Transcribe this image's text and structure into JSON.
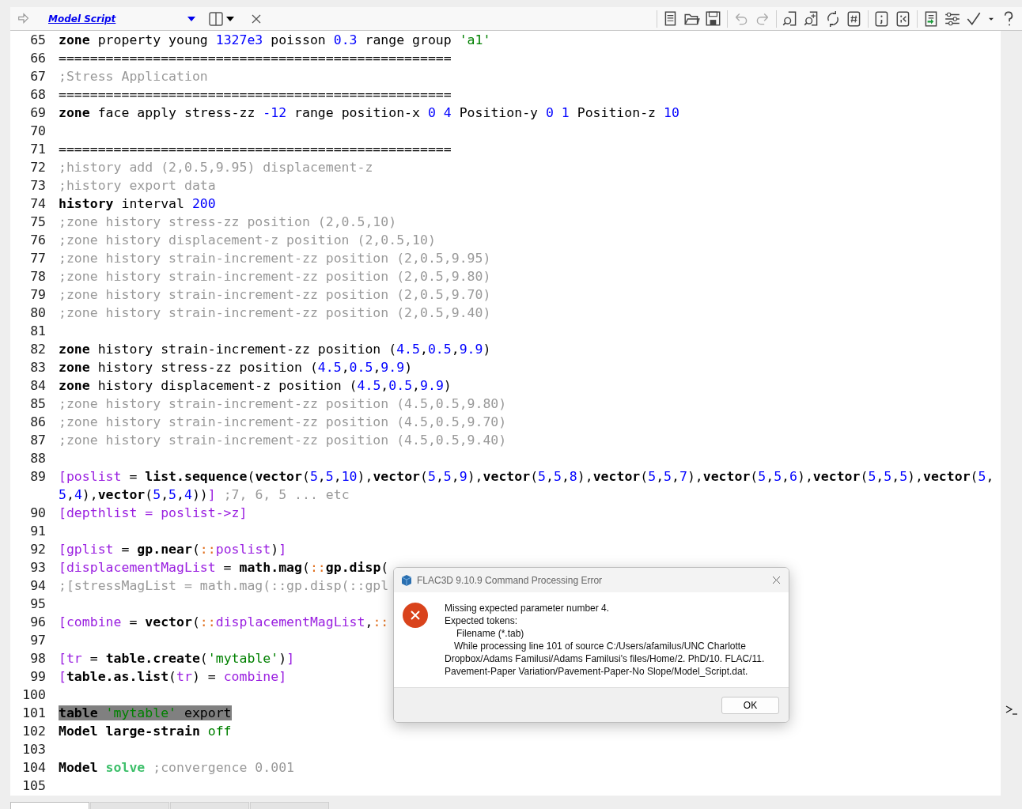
{
  "editor_tab": {
    "title": "Model Script"
  },
  "code": [
    {
      "n": "65",
      "tokens": [
        {
          "t": "zone",
          "kind": "kw"
        },
        {
          "t": " property young ",
          "kind": "plain"
        },
        {
          "t": "1327e3",
          "kind": "num"
        },
        {
          "t": " poisson ",
          "kind": "plain"
        },
        {
          "t": "0.3",
          "kind": "num"
        },
        {
          "t": " range group ",
          "kind": "plain"
        },
        {
          "t": "'a1'",
          "kind": "str"
        }
      ]
    },
    {
      "n": "66",
      "tokens": [
        {
          "t": "==================================================",
          "kind": "plain"
        }
      ]
    },
    {
      "n": "67",
      "tokens": [
        {
          "t": ";Stress Application",
          "kind": "cmt"
        }
      ]
    },
    {
      "n": "68",
      "tokens": [
        {
          "t": "==================================================",
          "kind": "plain"
        }
      ]
    },
    {
      "n": "69",
      "tokens": [
        {
          "t": "zone",
          "kind": "kw"
        },
        {
          "t": " face apply stress-zz ",
          "kind": "plain"
        },
        {
          "t": "-12",
          "kind": "num"
        },
        {
          "t": " range position-x ",
          "kind": "plain"
        },
        {
          "t": "0 4",
          "kind": "num"
        },
        {
          "t": " Position-y ",
          "kind": "plain"
        },
        {
          "t": "0 1",
          "kind": "num"
        },
        {
          "t": " Position-z ",
          "kind": "plain"
        },
        {
          "t": "10",
          "kind": "num"
        }
      ]
    },
    {
      "n": "70"
    },
    {
      "n": "71",
      "tokens": [
        {
          "t": "==================================================",
          "kind": "plain"
        }
      ]
    },
    {
      "n": "72",
      "tokens": [
        {
          "t": ";history add (2,0.5,9.95) displacement-z",
          "kind": "cmt"
        }
      ]
    },
    {
      "n": "73",
      "tokens": [
        {
          "t": ";history export data",
          "kind": "cmt"
        }
      ]
    },
    {
      "n": "74",
      "tokens": [
        {
          "t": "history",
          "kind": "kw"
        },
        {
          "t": " interval ",
          "kind": "plain"
        },
        {
          "t": "200",
          "kind": "num"
        }
      ]
    },
    {
      "n": "75",
      "tokens": [
        {
          "t": ";zone history stress-zz position (2,0.5,10)",
          "kind": "cmt"
        }
      ]
    },
    {
      "n": "76",
      "tokens": [
        {
          "t": ";zone history displacement-z position (2,0.5,10)",
          "kind": "cmt"
        }
      ]
    },
    {
      "n": "77",
      "tokens": [
        {
          "t": ";zone history strain-increment-zz position (2,0.5,9.95)",
          "kind": "cmt"
        }
      ]
    },
    {
      "n": "78",
      "tokens": [
        {
          "t": ";zone history strain-increment-zz position (2,0.5,9.80)",
          "kind": "cmt"
        }
      ]
    },
    {
      "n": "79",
      "tokens": [
        {
          "t": ";zone history strain-increment-zz position (2,0.5,9.70)",
          "kind": "cmt"
        }
      ]
    },
    {
      "n": "80",
      "tokens": [
        {
          "t": ";zone history strain-increment-zz position (2,0.5,9.40)",
          "kind": "cmt"
        }
      ]
    },
    {
      "n": "81"
    },
    {
      "n": "82",
      "tokens": [
        {
          "t": "zone",
          "kind": "kw"
        },
        {
          "t": " history strain-increment-zz position (",
          "kind": "plain"
        },
        {
          "t": "4.5",
          "kind": "num"
        },
        {
          "t": ",",
          "kind": "plain"
        },
        {
          "t": "0.5",
          "kind": "num"
        },
        {
          "t": ",",
          "kind": "plain"
        },
        {
          "t": "9.9",
          "kind": "num"
        },
        {
          "t": ")",
          "kind": "plain"
        }
      ]
    },
    {
      "n": "83",
      "tokens": [
        {
          "t": "zone",
          "kind": "kw"
        },
        {
          "t": " history stress-zz position (",
          "kind": "plain"
        },
        {
          "t": "4.5",
          "kind": "num"
        },
        {
          "t": ",",
          "kind": "plain"
        },
        {
          "t": "0.5",
          "kind": "num"
        },
        {
          "t": ",",
          "kind": "plain"
        },
        {
          "t": "9.9",
          "kind": "num"
        },
        {
          "t": ")",
          "kind": "plain"
        }
      ]
    },
    {
      "n": "84",
      "tokens": [
        {
          "t": "zone",
          "kind": "kw"
        },
        {
          "t": " history displacement-z position (",
          "kind": "plain"
        },
        {
          "t": "4.5",
          "kind": "num"
        },
        {
          "t": ",",
          "kind": "plain"
        },
        {
          "t": "0.5",
          "kind": "num"
        },
        {
          "t": ",",
          "kind": "plain"
        },
        {
          "t": "9.9",
          "kind": "num"
        },
        {
          "t": ")",
          "kind": "plain"
        }
      ]
    },
    {
      "n": "85",
      "tokens": [
        {
          "t": ";zone history strain-increment-zz position (4.5,0.5,9.80)",
          "kind": "cmt"
        }
      ]
    },
    {
      "n": "86",
      "tokens": [
        {
          "t": ";zone history strain-increment-zz position (4.5,0.5,9.70)",
          "kind": "cmt"
        }
      ]
    },
    {
      "n": "87",
      "tokens": [
        {
          "t": ";zone history strain-increment-zz position (4.5,0.5,9.40)",
          "kind": "cmt"
        }
      ]
    },
    {
      "n": "88"
    },
    {
      "n": "89",
      "tokens": [
        {
          "t": "[poslist",
          "kind": "var"
        },
        {
          "t": " = ",
          "kind": "plain"
        },
        {
          "t": "list.sequence",
          "kind": "fn"
        },
        {
          "t": "(",
          "kind": "plain"
        },
        {
          "t": "vector",
          "kind": "fn"
        },
        {
          "t": "(",
          "kind": "plain"
        },
        {
          "t": "5",
          "kind": "num"
        },
        {
          "t": ",",
          "kind": "plain"
        },
        {
          "t": "5",
          "kind": "num"
        },
        {
          "t": ",",
          "kind": "plain"
        },
        {
          "t": "10",
          "kind": "num"
        },
        {
          "t": "),",
          "kind": "plain"
        },
        {
          "t": "vector",
          "kind": "fn"
        },
        {
          "t": "(",
          "kind": "plain"
        },
        {
          "t": "5",
          "kind": "num"
        },
        {
          "t": ",",
          "kind": "plain"
        },
        {
          "t": "5",
          "kind": "num"
        },
        {
          "t": ",",
          "kind": "plain"
        },
        {
          "t": "9",
          "kind": "num"
        },
        {
          "t": "),",
          "kind": "plain"
        },
        {
          "t": "vector",
          "kind": "fn"
        },
        {
          "t": "(",
          "kind": "plain"
        },
        {
          "t": "5",
          "kind": "num"
        },
        {
          "t": ",",
          "kind": "plain"
        },
        {
          "t": "5",
          "kind": "num"
        },
        {
          "t": ",",
          "kind": "plain"
        },
        {
          "t": "8",
          "kind": "num"
        },
        {
          "t": "),",
          "kind": "plain"
        },
        {
          "t": "vector",
          "kind": "fn"
        },
        {
          "t": "(",
          "kind": "plain"
        },
        {
          "t": "5",
          "kind": "num"
        },
        {
          "t": ",",
          "kind": "plain"
        },
        {
          "t": "5",
          "kind": "num"
        },
        {
          "t": ",",
          "kind": "plain"
        },
        {
          "t": "7",
          "kind": "num"
        },
        {
          "t": "),",
          "kind": "plain"
        },
        {
          "t": "vector",
          "kind": "fn"
        },
        {
          "t": "(",
          "kind": "plain"
        },
        {
          "t": "5",
          "kind": "num"
        },
        {
          "t": ",",
          "kind": "plain"
        },
        {
          "t": "5",
          "kind": "num"
        },
        {
          "t": ",",
          "kind": "plain"
        },
        {
          "t": "6",
          "kind": "num"
        },
        {
          "t": "),",
          "kind": "plain"
        },
        {
          "t": "vector",
          "kind": "fn"
        },
        {
          "t": "(",
          "kind": "plain"
        },
        {
          "t": "5",
          "kind": "num"
        },
        {
          "t": ",",
          "kind": "plain"
        },
        {
          "t": "5",
          "kind": "num"
        },
        {
          "t": ",",
          "kind": "plain"
        },
        {
          "t": "5",
          "kind": "num"
        },
        {
          "t": "),",
          "kind": "plain"
        },
        {
          "t": "vector",
          "kind": "fn"
        },
        {
          "t": "(",
          "kind": "plain"
        },
        {
          "t": "5",
          "kind": "num"
        },
        {
          "t": ",",
          "kind": "plain"
        },
        {
          "t": "5",
          "kind": "num"
        },
        {
          "t": ",",
          "kind": "plain"
        },
        {
          "t": "4",
          "kind": "num"
        },
        {
          "t": "),",
          "kind": "plain"
        },
        {
          "t": "vector",
          "kind": "fn"
        },
        {
          "t": "(",
          "kind": "plain"
        },
        {
          "t": "5",
          "kind": "num"
        },
        {
          "t": ",",
          "kind": "plain"
        },
        {
          "t": "5",
          "kind": "num"
        },
        {
          "t": ",",
          "kind": "plain"
        },
        {
          "t": "4",
          "kind": "num"
        },
        {
          "t": "))",
          "kind": "plain"
        },
        {
          "t": "]",
          "kind": "var"
        },
        {
          "t": " ;7, 6, 5 ... etc",
          "kind": "cmt"
        }
      ]
    },
    {
      "n": "90",
      "tokens": [
        {
          "t": "[depthlist = poslist->z]",
          "kind": "var"
        }
      ]
    },
    {
      "n": "91"
    },
    {
      "n": "92",
      "tokens": [
        {
          "t": "[gplist",
          "kind": "var"
        },
        {
          "t": " = ",
          "kind": "plain"
        },
        {
          "t": "gp.near",
          "kind": "fn"
        },
        {
          "t": "(",
          "kind": "plain"
        },
        {
          "t": "::",
          "kind": "op"
        },
        {
          "t": "poslist",
          "kind": "var"
        },
        {
          "t": ")",
          "kind": "plain"
        },
        {
          "t": "]",
          "kind": "var"
        }
      ]
    },
    {
      "n": "93",
      "tokens": [
        {
          "t": "[displacementMagList",
          "kind": "var"
        },
        {
          "t": " = ",
          "kind": "plain"
        },
        {
          "t": "math.mag",
          "kind": "fn"
        },
        {
          "t": "(",
          "kind": "plain"
        },
        {
          "t": "::",
          "kind": "op"
        },
        {
          "t": "gp.disp",
          "kind": "fn"
        },
        {
          "t": "(",
          "kind": "plain"
        }
      ]
    },
    {
      "n": "94",
      "tokens": [
        {
          "t": ";[stressMagList = math.mag(::gp.disp(::gpl",
          "kind": "cmt"
        }
      ]
    },
    {
      "n": "95"
    },
    {
      "n": "96",
      "tokens": [
        {
          "t": "[combine",
          "kind": "var"
        },
        {
          "t": " = ",
          "kind": "plain"
        },
        {
          "t": "vector",
          "kind": "fn"
        },
        {
          "t": "(",
          "kind": "plain"
        },
        {
          "t": "::",
          "kind": "op"
        },
        {
          "t": "displacementMagList",
          "kind": "var"
        },
        {
          "t": ",",
          "kind": "plain"
        },
        {
          "t": "::",
          "kind": "op"
        }
      ]
    },
    {
      "n": "97"
    },
    {
      "n": "98",
      "tokens": [
        {
          "t": "[tr",
          "kind": "var"
        },
        {
          "t": " = ",
          "kind": "plain"
        },
        {
          "t": "table.create",
          "kind": "fn"
        },
        {
          "t": "(",
          "kind": "plain"
        },
        {
          "t": "'mytable'",
          "kind": "str"
        },
        {
          "t": ")",
          "kind": "plain"
        },
        {
          "t": "]",
          "kind": "var"
        }
      ]
    },
    {
      "n": "99",
      "tokens": [
        {
          "t": "[",
          "kind": "var"
        },
        {
          "t": "table.as.list",
          "kind": "fn"
        },
        {
          "t": "(",
          "kind": "plain"
        },
        {
          "t": "tr",
          "kind": "var"
        },
        {
          "t": ")",
          "kind": "plain"
        },
        {
          "t": " = ",
          "kind": "plain"
        },
        {
          "t": "combine",
          "kind": "var"
        },
        {
          "t": "]",
          "kind": "var"
        }
      ]
    },
    {
      "n": "100"
    },
    {
      "n": "101",
      "highlighted": true,
      "tokens": [
        {
          "t": "table ",
          "kind": "kw"
        },
        {
          "t": "'mytable'",
          "kind": "str"
        },
        {
          "t": " export",
          "kind": "plain"
        }
      ]
    },
    {
      "n": "102",
      "tokens": [
        {
          "t": "Model ",
          "kind": "kw"
        },
        {
          "t": "large-strain ",
          "kind": "kw"
        },
        {
          "t": "off",
          "kind": "str"
        }
      ]
    },
    {
      "n": "103"
    },
    {
      "n": "104",
      "tokens": [
        {
          "t": "Model ",
          "kind": "kw"
        },
        {
          "t": "solve",
          "kind": "lit"
        },
        {
          "t": " ;convergence 0.001",
          "kind": "cmt"
        }
      ]
    },
    {
      "n": "105"
    }
  ],
  "dialog": {
    "title": "FLAC3D 9.10.9 Command Processing Error",
    "message": [
      {
        "text": "Missing expected parameter number 4.",
        "kind": "plain"
      },
      {
        "text": "Expected tokens:",
        "kind": "plain"
      },
      {
        "text": "Filename (*.tab)",
        "kind": "deep"
      },
      {
        "text": "While processing line 101 of source C:/Users/afamilus/UNC Charlotte Dropbox/Adams Familusi/Adams Familusi's files/Home/2. PhD/10. FLAC/11. Pavement-Paper Variation/Pavement-Paper-No Slope/Model_Script.dat.",
        "kind": "first"
      }
    ],
    "buttons": [
      "OK"
    ]
  },
  "bottom_tabs": [
    {
      "selected": true
    },
    {
      "selected": false
    },
    {
      "selected": false
    },
    {
      "selected": false
    }
  ]
}
